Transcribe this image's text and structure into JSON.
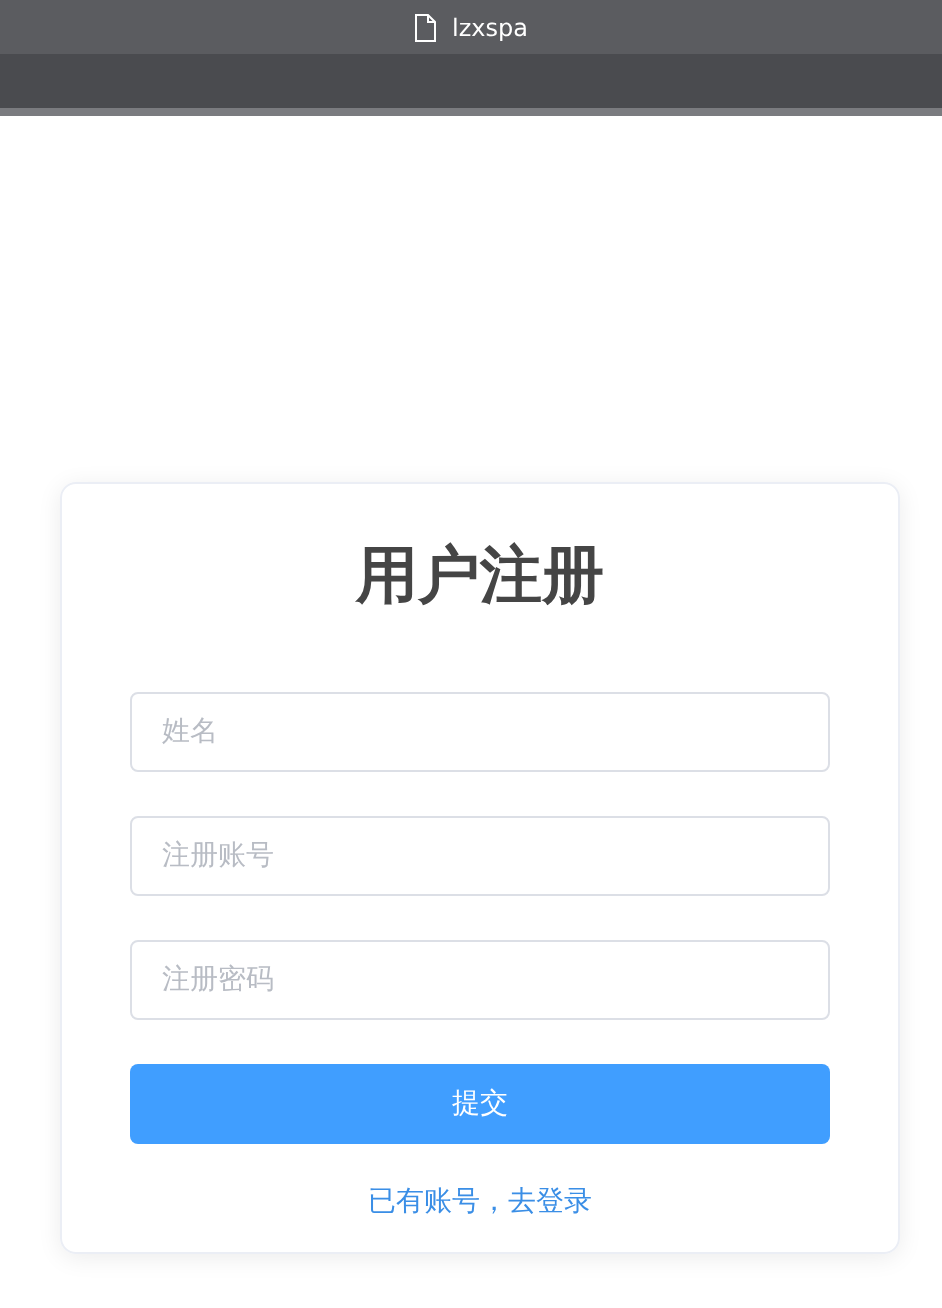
{
  "window": {
    "title": "lzxspa"
  },
  "form": {
    "title": "用户注册",
    "fields": [
      {
        "placeholder": "姓名"
      },
      {
        "placeholder": "注册账号"
      },
      {
        "placeholder": "注册密码"
      }
    ],
    "submit": "提交",
    "login_link": "已有账号，去登录"
  }
}
